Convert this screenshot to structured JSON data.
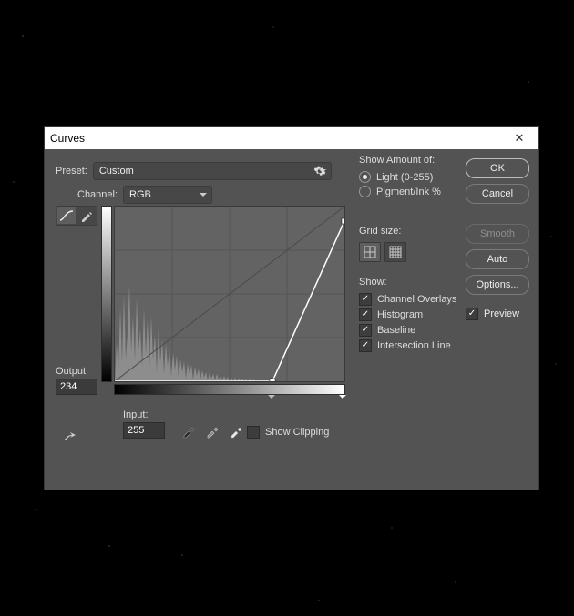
{
  "dialog": {
    "title": "Curves",
    "preset_label": "Preset:",
    "preset_value": "Custom",
    "channel_label": "Channel:",
    "channel_value": "RGB",
    "output_label": "Output:",
    "output_value": "234",
    "input_label": "Input:",
    "input_value": "255",
    "show_clipping_label": "Show Clipping",
    "show_clipping_checked": false
  },
  "curve": {
    "points": [
      {
        "input": 175,
        "output": 0
      },
      {
        "input": 255,
        "output": 234
      }
    ],
    "black_slider": 175,
    "white_slider": 255
  },
  "right": {
    "show_amount_title": "Show Amount of:",
    "amount_options": [
      {
        "label": "Light  (0-255)",
        "selected": true
      },
      {
        "label": "Pigment/Ink %",
        "selected": false
      }
    ],
    "grid_title": "Grid size:",
    "grid_selected": 0,
    "show_title": "Show:",
    "show_options": [
      {
        "label": "Channel Overlays",
        "checked": true
      },
      {
        "label": "Histogram",
        "checked": true
      },
      {
        "label": "Baseline",
        "checked": true
      },
      {
        "label": "Intersection Line",
        "checked": true
      }
    ]
  },
  "buttons": {
    "ok": "OK",
    "cancel": "Cancel",
    "smooth": "Smooth",
    "auto": "Auto",
    "options": "Options...",
    "preview_label": "Preview",
    "preview_checked": true
  },
  "colors": {
    "dialog_bg": "#535353",
    "panel_bg": "#474747",
    "graph_bg": "#636363",
    "histogram": "#8d8d8d",
    "curve_line": "#ffffff"
  }
}
